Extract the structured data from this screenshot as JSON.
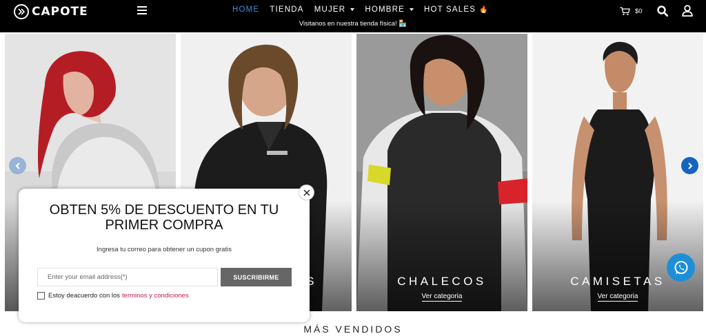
{
  "header": {
    "logo_text": "CAPOTE",
    "nav": [
      {
        "label": "HOME",
        "active": true,
        "dropdown": false
      },
      {
        "label": "TIENDA",
        "active": false,
        "dropdown": false
      },
      {
        "label": "MUJER",
        "active": false,
        "dropdown": true
      },
      {
        "label": "HOMBRE",
        "active": false,
        "dropdown": true
      },
      {
        "label": "HOT SALES",
        "active": false,
        "dropdown": false,
        "icon": "fire-icon"
      }
    ],
    "notice": "Visitanos en nuestra tienda física! 🏪",
    "cart_total": "$0"
  },
  "tiles": [
    {
      "title": "",
      "link": ""
    },
    {
      "title": "S",
      "link": ""
    },
    {
      "title": "CHALECOS",
      "link": "Ver categoria"
    },
    {
      "title": "CAMISETAS",
      "link": "Ver categoria"
    }
  ],
  "section_title": "MÁS VENDIDOS",
  "popup": {
    "title": "OBTEN 5% DE DESCUENTO EN TU PRIMER COMPRA",
    "subtitle": "Ingresa tu correo para obtener un cupon gratis",
    "email_placeholder": "Enter your email address(*)",
    "email_value": "",
    "submit_label": "SUSCRIBIRME",
    "consent_text": "Estoy deacuerdo con los",
    "consent_link": "terminos y condiciones",
    "consent_checked": false
  },
  "colors": {
    "header_bg": "#000000",
    "active_nav": "#3d8fe0",
    "button_bg": "#666666",
    "link": "#c2185b",
    "whatsapp_bg": "#1e8fd6",
    "arrow_active": "#1565c0"
  }
}
